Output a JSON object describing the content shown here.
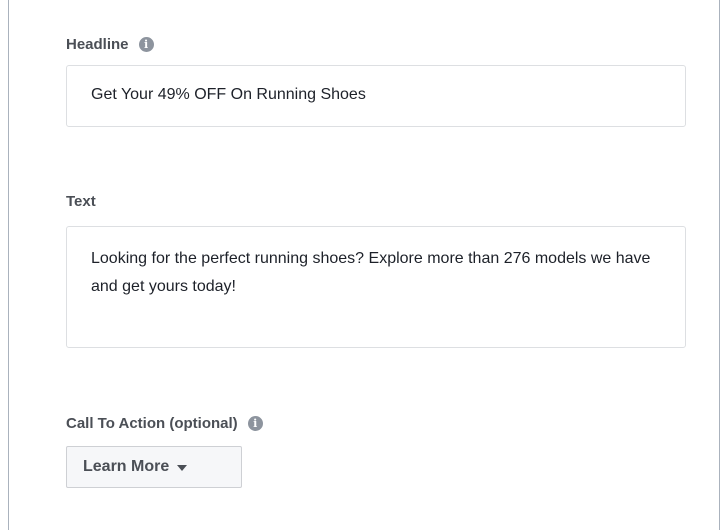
{
  "headline": {
    "label": "Headline",
    "value": "Get Your 49% OFF On Running Shoes",
    "info_icon": "info-icon"
  },
  "text": {
    "label": "Text",
    "value": "Looking for the perfect running shoes? Explore more than 276 models we have and get yours today!"
  },
  "call_to_action": {
    "label": "Call To Action (optional)",
    "info_icon": "info-icon",
    "selected": "Learn More",
    "dropdown_icon": "caret-down-icon"
  },
  "colors": {
    "label": "#4b4f56",
    "input_text": "#1d2129",
    "input_border": "#dddfe2",
    "button_bg": "#f6f7f9",
    "info_icon_bg": "#8d949e"
  }
}
